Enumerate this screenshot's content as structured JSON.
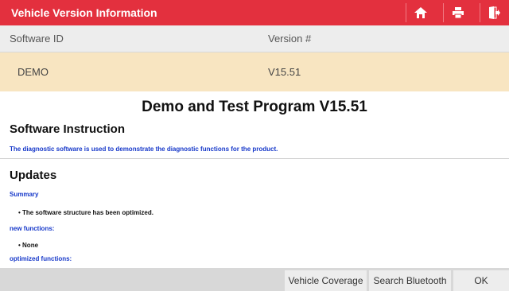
{
  "window": {
    "title": "Vehicle Version Information"
  },
  "toolbar_icons": [
    "home-icon",
    "print-icon",
    "exit-icon"
  ],
  "table": {
    "headers": [
      "Software ID",
      "Version #"
    ],
    "row": [
      "DEMO",
      "V15.51"
    ]
  },
  "content": {
    "main_title": "Demo and Test Program V15.51",
    "section1_title": "Software Instruction",
    "section1_text": "The diagnostic software is used to demonstrate the diagnostic functions for the product.",
    "section2_title": "Updates",
    "summary_label": "Summary",
    "summary_item": "The software structure has been optimized.",
    "new_label": "new functions:",
    "new_item": "None",
    "optimized_label": "optimized functions:"
  },
  "footer": {
    "buttons": [
      "Vehicle Coverage",
      "Search Bluetooth",
      "OK"
    ]
  },
  "colors": {
    "accent": "#e3303e",
    "link": "#1537c9",
    "highlight_row": "#f8e5c1"
  }
}
